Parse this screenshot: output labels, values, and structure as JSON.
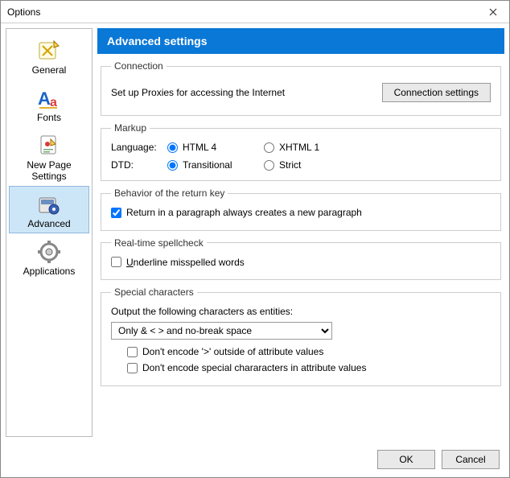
{
  "window": {
    "title": "Options"
  },
  "sidebar": {
    "items": [
      {
        "label": "General"
      },
      {
        "label": "Fonts"
      },
      {
        "label": "New Page Settings"
      },
      {
        "label": "Advanced"
      },
      {
        "label": "Applications"
      }
    ]
  },
  "header": {
    "title": "Advanced settings"
  },
  "connection": {
    "legend": "Connection",
    "text": "Set up Proxies for accessing the Internet",
    "button": "Connection settings"
  },
  "markup": {
    "legend": "Markup",
    "language_label": "Language:",
    "language_opts": [
      "HTML 4",
      "XHTML 1"
    ],
    "dtd_label": "DTD:",
    "dtd_opts": [
      "Transitional",
      "Strict"
    ]
  },
  "behavior": {
    "legend": "Behavior of the return key",
    "check": "Return in a paragraph always creates a new paragraph"
  },
  "spellcheck": {
    "legend": "Real-time spellcheck",
    "check": "Underline misspelled words"
  },
  "special": {
    "legend": "Special characters",
    "text": "Output the following characters as entities:",
    "dropdown": "Only & < > and no-break space",
    "check1": "Don't encode '>' outside of attribute values",
    "check2": "Don't encode special chararacters in attribute values"
  },
  "footer": {
    "ok": "OK",
    "cancel": "Cancel"
  }
}
